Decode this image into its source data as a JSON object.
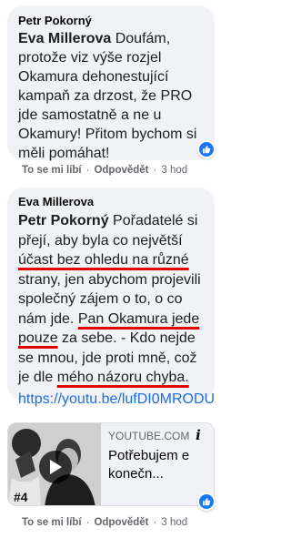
{
  "comment1": {
    "author": "Petr Pokorný",
    "mention": "Eva Millerova",
    "text": " Doufám, protože viz výše rozjel Okamura dehonestující kampaň za drzost, že PRO jde samostatně a ne u Okamury! Přitom bychom si měli pomáhat!",
    "actions": {
      "like": "To se mi líbí",
      "reply": "Odpovědět",
      "time": "3 hod"
    }
  },
  "comment2": {
    "author": "Eva Millerova",
    "mention": "Petr Pokorný",
    "text_a": " Pořadatelé si přejí, aby byla co největší ",
    "underline_1": "účast bez ohledu na různé",
    "text_b": " strany, jen abychom projevili společný zájem o to, o co nám jde. ",
    "underline_2": "Pan Okamura jede pouze",
    "text_c": " za sebe. - Kdo nejde se mnou, jde proti mně, což je dle ",
    "underline_3": "mého názoru chyba.",
    "link": "https://youtu.be/lufDI0MRODU",
    "card": {
      "domain": "YOUTUBE.COM",
      "title": "Potřebujem e konečn..."
    },
    "actions": {
      "like": "To se mi líbí",
      "reply": "Odpovědět",
      "time": "3 hod"
    }
  },
  "colors": {
    "bubble": "#f0f2f5",
    "link": "#216fdb",
    "underline": "#e00000",
    "like": "#1877f2"
  }
}
